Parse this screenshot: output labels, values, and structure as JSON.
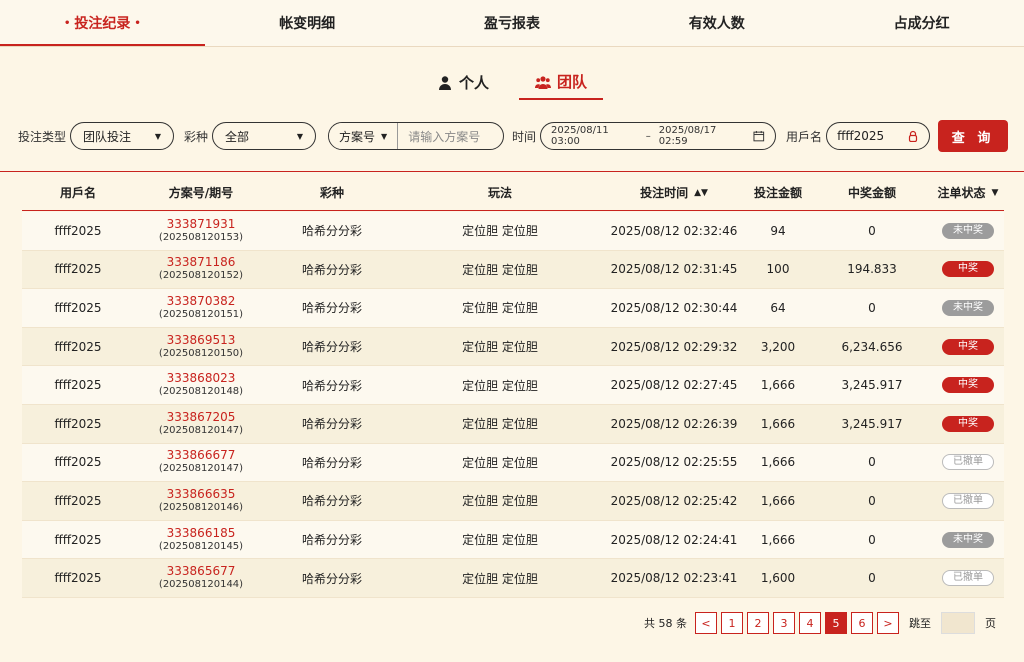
{
  "top_tabs": [
    {
      "label": "投注纪录",
      "active": true
    },
    {
      "label": "帐变明细"
    },
    {
      "label": "盈亏报表"
    },
    {
      "label": "有效人数"
    },
    {
      "label": "占成分红"
    }
  ],
  "active_dot": "•",
  "sub_tabs": [
    {
      "label": "个人",
      "icon": "person-icon"
    },
    {
      "label": "团队",
      "icon": "team-icon",
      "active": true
    }
  ],
  "filters": {
    "bet_type_label": "投注类型",
    "bet_type_value": "团队投注",
    "lottery_label": "彩种",
    "lottery_value": "全部",
    "plan_select": "方案号",
    "plan_placeholder": "请输入方案号",
    "time_label": "时间",
    "date_from": "2025/08/11 03:00",
    "date_sep": "–",
    "date_to": "2025/08/17 02:59",
    "user_label": "用戶名",
    "user_value": "ffff2025",
    "search_button": "查 询"
  },
  "table": {
    "headers": [
      "用戶名",
      "方案号/期号",
      "彩种",
      "玩法",
      "投注时间",
      "投注金额",
      "中奖金额",
      "注单状态"
    ],
    "rows": [
      {
        "user": "ffff2025",
        "plan": "333871931",
        "period": "(202508120153)",
        "lottery": "哈希分分彩",
        "play": "定位胆 定位胆",
        "time": "2025/08/12 02:32:46",
        "amount": "94",
        "win": "0",
        "status": "未中奖",
        "status_type": "lose"
      },
      {
        "user": "ffff2025",
        "plan": "333871186",
        "period": "(202508120152)",
        "lottery": "哈希分分彩",
        "play": "定位胆 定位胆",
        "time": "2025/08/12 02:31:45",
        "amount": "100",
        "win": "194.833",
        "status": "中奖",
        "status_type": "win"
      },
      {
        "user": "ffff2025",
        "plan": "333870382",
        "period": "(202508120151)",
        "lottery": "哈希分分彩",
        "play": "定位胆 定位胆",
        "time": "2025/08/12 02:30:44",
        "amount": "64",
        "win": "0",
        "status": "未中奖",
        "status_type": "lose"
      },
      {
        "user": "ffff2025",
        "plan": "333869513",
        "period": "(202508120150)",
        "lottery": "哈希分分彩",
        "play": "定位胆 定位胆",
        "time": "2025/08/12 02:29:32",
        "amount": "3,200",
        "win": "6,234.656",
        "status": "中奖",
        "status_type": "win"
      },
      {
        "user": "ffff2025",
        "plan": "333868023",
        "period": "(202508120148)",
        "lottery": "哈希分分彩",
        "play": "定位胆 定位胆",
        "time": "2025/08/12 02:27:45",
        "amount": "1,666",
        "win": "3,245.917",
        "status": "中奖",
        "status_type": "win"
      },
      {
        "user": "ffff2025",
        "plan": "333867205",
        "period": "(202508120147)",
        "lottery": "哈希分分彩",
        "play": "定位胆 定位胆",
        "time": "2025/08/12 02:26:39",
        "amount": "1,666",
        "win": "3,245.917",
        "status": "中奖",
        "status_type": "win"
      },
      {
        "user": "ffff2025",
        "plan": "333866677",
        "period": "(202508120147)",
        "lottery": "哈希分分彩",
        "play": "定位胆 定位胆",
        "time": "2025/08/12 02:25:55",
        "amount": "1,666",
        "win": "0",
        "status": "已撤单",
        "status_type": "cancel"
      },
      {
        "user": "ffff2025",
        "plan": "333866635",
        "period": "(202508120146)",
        "lottery": "哈希分分彩",
        "play": "定位胆 定位胆",
        "time": "2025/08/12 02:25:42",
        "amount": "1,666",
        "win": "0",
        "status": "已撤单",
        "status_type": "cancel"
      },
      {
        "user": "ffff2025",
        "plan": "333866185",
        "period": "(202508120145)",
        "lottery": "哈希分分彩",
        "play": "定位胆 定位胆",
        "time": "2025/08/12 02:24:41",
        "amount": "1,666",
        "win": "0",
        "status": "未中奖",
        "status_type": "lose"
      },
      {
        "user": "ffff2025",
        "plan": "333865677",
        "period": "(202508120144)",
        "lottery": "哈希分分彩",
        "play": "定位胆 定位胆",
        "time": "2025/08/12 02:23:41",
        "amount": "1,600",
        "win": "0",
        "status": "已撤单",
        "status_type": "cancel"
      }
    ]
  },
  "pagination": {
    "total": "共 58 条",
    "prev": "<",
    "pages": [
      "1",
      "2",
      "3",
      "4",
      "5",
      "6"
    ],
    "current": "5",
    "next": ">",
    "jump_label": "跳至",
    "page_suffix": "页"
  },
  "colors": {
    "accent": "#c8231e",
    "background": "#fdf8ec"
  }
}
